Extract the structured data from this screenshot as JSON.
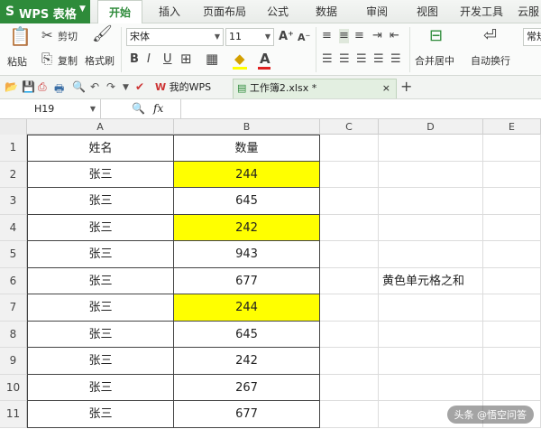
{
  "brand": {
    "logo": "S",
    "name": "WPS 表格",
    "dropdown": "▼"
  },
  "menu": {
    "tabs": [
      "开始",
      "插入",
      "页面布局",
      "公式",
      "数据",
      "审阅",
      "视图",
      "开发工具",
      "云服"
    ],
    "active": "开始"
  },
  "ribbon": {
    "paste": "粘贴",
    "cut": "剪切",
    "copy": "复制",
    "format_painter": "格式刷",
    "font_name": "宋体",
    "font_size": "11",
    "bold": "B",
    "italic": "I",
    "underline": "U",
    "merge_center": "合并居中",
    "wrap_text": "自动换行",
    "number_format": "常规"
  },
  "quickbar": {
    "tabs": [
      {
        "label": "我的WPS",
        "active": false
      },
      {
        "label": "工作簿2.xlsx *",
        "active": true
      }
    ],
    "close": "×",
    "new_tab": "+"
  },
  "formula_bar": {
    "cell_ref": "H19",
    "fx": "fx",
    "value": ""
  },
  "sheet": {
    "columns": [
      "A",
      "B",
      "C",
      "D",
      "E"
    ],
    "header_row": {
      "row": "1",
      "a": "姓名",
      "b": "数量"
    },
    "rows": [
      {
        "row": "2",
        "a": "张三",
        "b": "244",
        "yellow": true
      },
      {
        "row": "3",
        "a": "张三",
        "b": "645",
        "yellow": false
      },
      {
        "row": "4",
        "a": "张三",
        "b": "242",
        "yellow": true
      },
      {
        "row": "5",
        "a": "张三",
        "b": "943",
        "yellow": false
      },
      {
        "row": "6",
        "a": "张三",
        "b": "677",
        "yellow": false,
        "d": "黄色单元格之和"
      },
      {
        "row": "7",
        "a": "张三",
        "b": "244",
        "yellow": true
      },
      {
        "row": "8",
        "a": "张三",
        "b": "645",
        "yellow": false
      },
      {
        "row": "9",
        "a": "张三",
        "b": "242",
        "yellow": false
      },
      {
        "row": "10",
        "a": "张三",
        "b": "267",
        "yellow": false
      },
      {
        "row": "11",
        "a": "张三",
        "b": "677",
        "yellow": false
      }
    ],
    "highlight_color": "#ffff00"
  },
  "watermark": "头条 @悟空问答"
}
